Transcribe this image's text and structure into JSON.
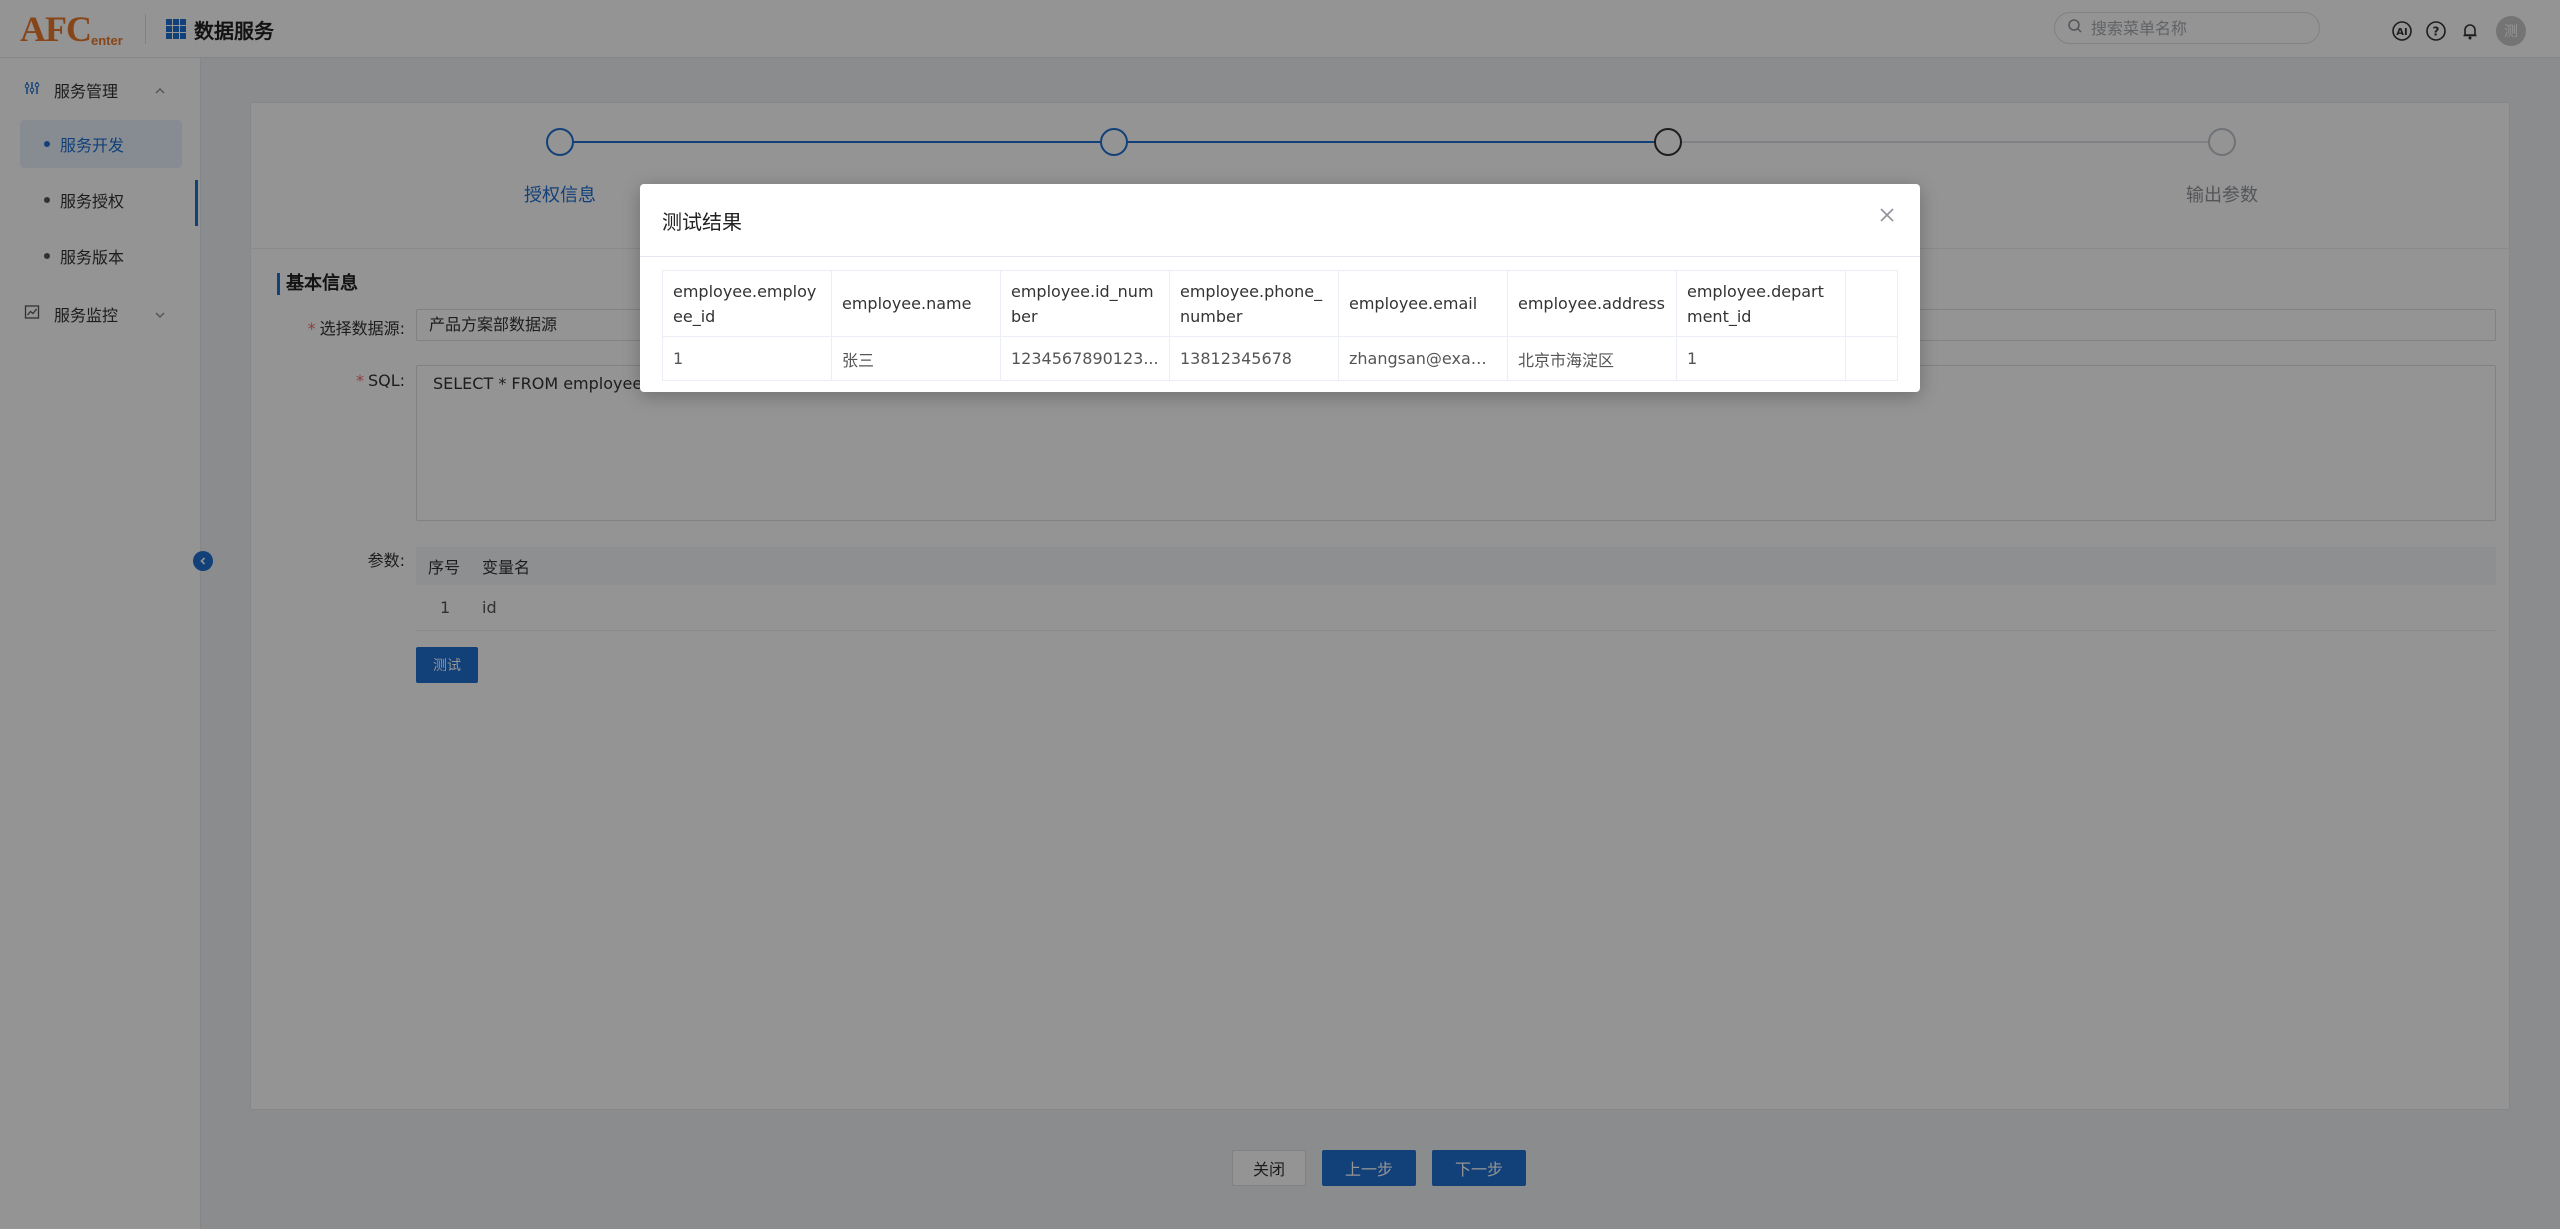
{
  "header": {
    "logo_big": "AFC",
    "logo_small": "enter",
    "app_title": "数据服务",
    "search_placeholder": "搜索菜单名称",
    "avatar_text": "测"
  },
  "sidebar": {
    "groups": [
      {
        "label": "服务管理",
        "icon": "service-manage-icon",
        "expanded": true
      },
      {
        "label": "服务监控",
        "icon": "chart-icon",
        "expanded": false
      }
    ],
    "items": [
      {
        "label": "服务开发",
        "active": true
      },
      {
        "label": "服务授权",
        "active": false
      },
      {
        "label": "服务版本",
        "active": false
      }
    ]
  },
  "steps": [
    {
      "label": "授权信息",
      "state": "done"
    },
    {
      "label": "",
      "state": "done"
    },
    {
      "label": "",
      "state": "current"
    },
    {
      "label": "输出参数",
      "state": "pending"
    }
  ],
  "form": {
    "section_title": "基本信息",
    "datasource_label": "选择数据源:",
    "datasource_value": "产品方案部数据源",
    "sql_label": "SQL:",
    "sql_value": "SELECT * FROM employee wh",
    "params_label": "参数:",
    "params_headers": [
      "序号",
      "变量名"
    ],
    "params_rows": [
      {
        "index": "1",
        "name": "id"
      }
    ],
    "test_button": "测试"
  },
  "footer": {
    "close_label": "关闭",
    "prev_label": "上一步",
    "next_label": "下一步"
  },
  "dialog": {
    "title": "测试结果",
    "columns": [
      "employee.employee_id",
      "employee.name",
      "employee.id_number",
      "employee.phone_number",
      "employee.email",
      "employee.address",
      "employee.department_id"
    ],
    "rows": [
      [
        "1",
        "张三",
        "1234567890123...",
        "13812345678",
        "zhangsan@exam...",
        "北京市海淀区",
        "1"
      ]
    ]
  },
  "colors": {
    "primary": "#1f6fd1",
    "logo": "#e8792b",
    "required": "#f56c6c"
  }
}
